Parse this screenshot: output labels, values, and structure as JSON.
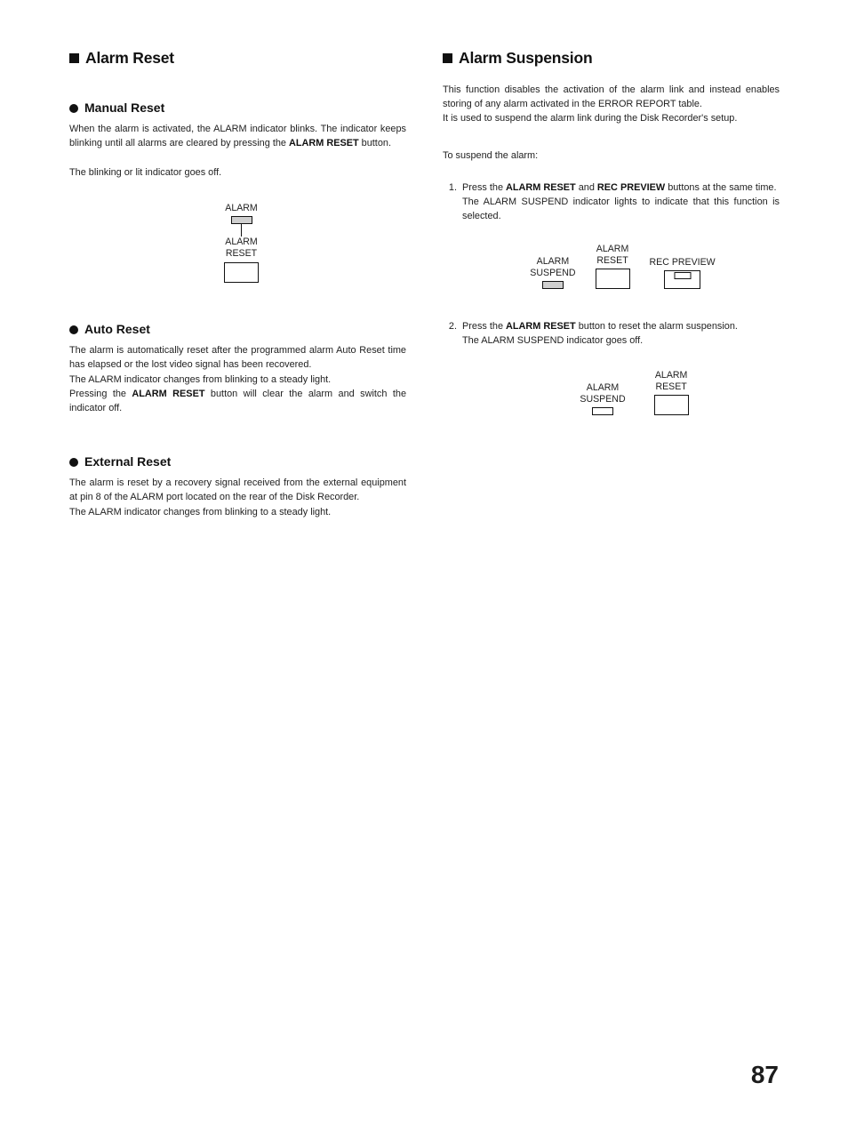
{
  "page": {
    "number": "87"
  },
  "left_column": {
    "heading": "Alarm Reset",
    "sections": [
      {
        "title": "Manual Reset",
        "paragraph_1": "When the alarm is activated, the ALARM indicator blinks. The indicator keeps blinking until all alarms are cleared by pressing the ",
        "paragraph_1_bold": "ALARM RESET",
        "paragraph_1_tail": " button.",
        "paragraph_2": "The blinking or lit indicator goes off."
      },
      {
        "title": "Auto Reset",
        "paragraph_1": "The alarm is automatically reset after the programmed alarm Auto Reset time has elapsed or the lost video signal has been recovered.",
        "paragraph_2": "The ALARM indicator changes from blinking to a steady light.",
        "paragraph_3_head": "Pressing the ",
        "paragraph_3_bold": "ALARM RESET",
        "paragraph_3_tail": " button will clear the alarm and switch the indicator off."
      },
      {
        "title": "External Reset",
        "paragraph_1": "The alarm is reset by a recovery signal received from the external equipment at pin 8 of the ALARM port located on the rear of the Disk Recorder.",
        "paragraph_2": "The ALARM indicator changes from blinking to a steady light."
      }
    ],
    "diagram_manual": {
      "alarm_label": "ALARM",
      "alarm_reset_label": "ALARM\nRESET"
    }
  },
  "right_column": {
    "heading": "Alarm Suspension",
    "intro_1": "This function disables the activation of the alarm link and instead enables storing of any alarm activated in the ERROR REPORT table.",
    "intro_2": "It is used to suspend the alarm link during the Disk Recorder's setup.",
    "lead_in": "To suspend the alarm:",
    "steps": [
      {
        "number": "1.",
        "text_head": "Press the ",
        "bold_1": "ALARM RESET",
        "text_mid": " and ",
        "bold_2": "REC PREVIEW",
        "text_tail": " buttons at the same time.",
        "text_line_2": "The ALARM SUSPEND indicator lights to indicate that this function is selected."
      },
      {
        "number": "2.",
        "text_head": "Press the ",
        "bold_1": "ALARM RESET",
        "text_tail": " button to reset the alarm suspension.",
        "text_line_2": "The ALARM SUSPEND indicator goes off."
      }
    ],
    "diagram_suspend_on": {
      "alarm_suspend_label": "ALARM\nSUSPEND",
      "alarm_reset_label": "ALARM\nRESET",
      "rec_preview_label": "REC PREVIEW"
    },
    "diagram_suspend_off": {
      "alarm_suspend_label": "ALARM\nSUSPEND",
      "alarm_reset_label": "ALARM\nRESET"
    }
  }
}
